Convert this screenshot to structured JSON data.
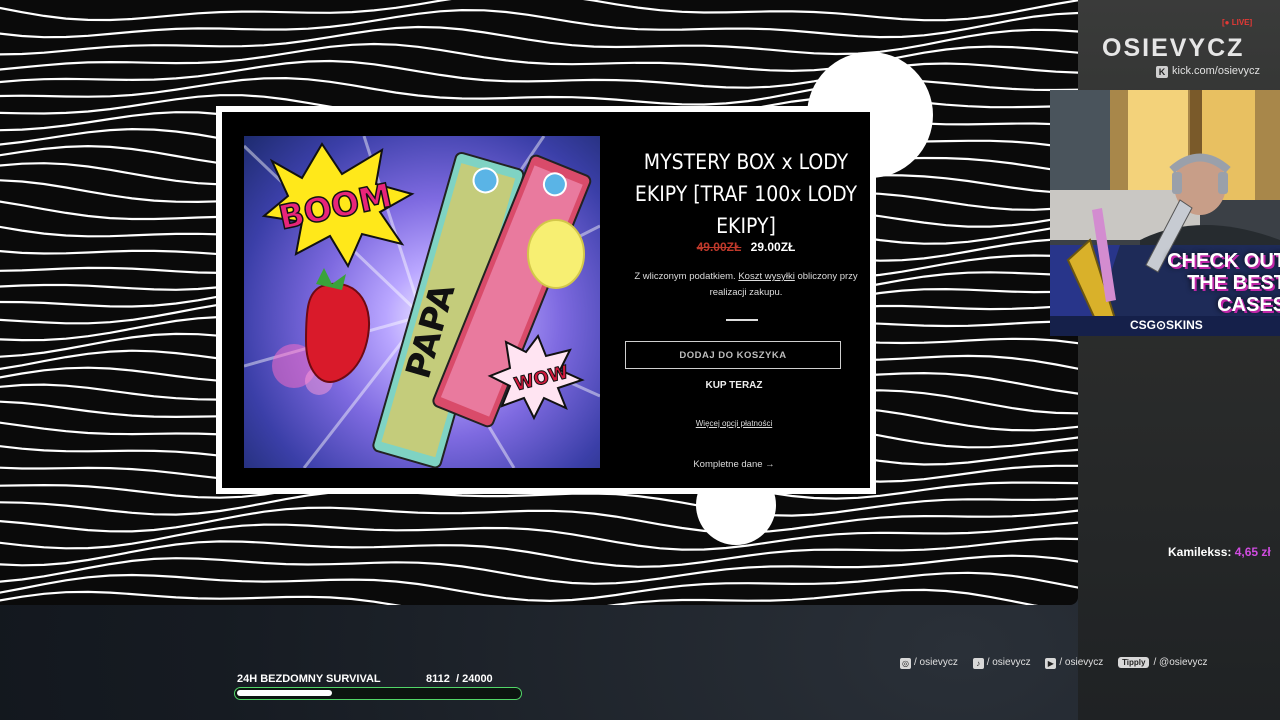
{
  "overlay": {
    "brand": "OSIEVYCZ",
    "live_badge": "[● LIVE]",
    "kick_url": "kick.com/osievycz",
    "kick_icon": "K",
    "donation": {
      "name": "Kamilekss:",
      "amount": "4,65 zł"
    },
    "webcam_ad": {
      "line1": "CHECK OUT",
      "line2": "THE BEST",
      "line3": "CASES",
      "brand": "CSG⊙SKINS"
    },
    "socials": [
      {
        "icon": "instagram-icon",
        "glyph": "◎",
        "handle": "/ osievycz"
      },
      {
        "icon": "tiktok-icon",
        "glyph": "♪",
        "handle": "/ osievycz"
      },
      {
        "icon": "youtube-icon",
        "glyph": "▶",
        "handle": "/ osievycz"
      }
    ],
    "tipply": {
      "badge": "Tipply",
      "handle": "/ @osievycz"
    },
    "goal": {
      "label": "24H BEZDOMNY SURVIVAL",
      "current": 8112,
      "target": 24000,
      "text": "8112  / 24000",
      "fraction": 0.338
    },
    "colors": {
      "goal_border": "#52d668",
      "donation_amount": "#d04ce0",
      "live": "#e53935"
    }
  },
  "product": {
    "title_lines": [
      "MYSTERY BOX x LODY",
      "EKIPY [TRAF 100x LODY",
      "EKIPY]"
    ],
    "old_price": "49.00ZŁ",
    "price": "29.00ZŁ",
    "tax_note_a": "Z wliczonym podatkiem.",
    "tax_note_link": "Koszt wysyłki",
    "tax_note_b": "obliczony przy realizacji zakupu.",
    "add_to_cart": "DODAJ DO KOSZYKA",
    "buy_now": "KUP TERAZ",
    "more_payment": "Więcej opcji płatności",
    "full_data": "Kompletne dane →",
    "image": {
      "boom": "BOOM",
      "wow": "WOW",
      "wrapper_text": "PAPA",
      "colors": {
        "boom_text": "#e8247a",
        "boom_burst": "#ffe81a",
        "strawberry": "#d91a2a",
        "old_price": "#c0392b"
      }
    }
  }
}
